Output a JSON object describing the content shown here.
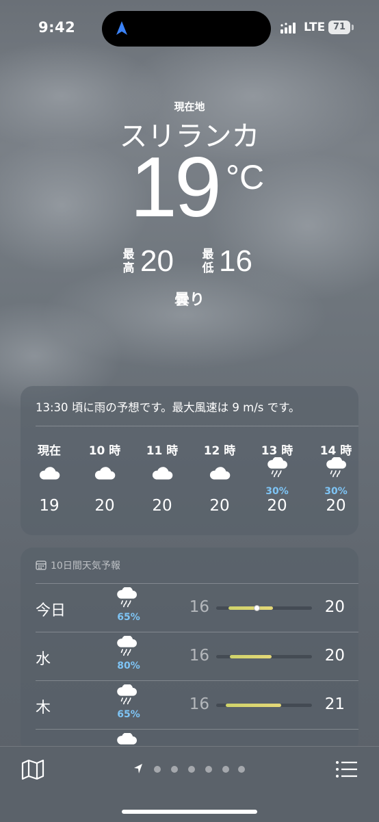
{
  "status_bar": {
    "time": "9:42",
    "network": "LTE",
    "battery": "71"
  },
  "location": {
    "label": "現在地",
    "city": "スリランカ"
  },
  "current": {
    "temp": "19",
    "unit": "°C",
    "high_label": "最高",
    "high": "20",
    "low_label": "最低",
    "low": "16",
    "condition": "曇り"
  },
  "hourly": {
    "summary": "13:30 頃に雨の予想です。最大風速は 9 m/s です。",
    "items": [
      {
        "label": "現在",
        "icon": "cloud-icon",
        "pct": "",
        "temp": "19"
      },
      {
        "label": "10 時",
        "icon": "cloud-icon",
        "pct": "",
        "temp": "20"
      },
      {
        "label": "11 時",
        "icon": "cloud-icon",
        "pct": "",
        "temp": "20"
      },
      {
        "label": "12 時",
        "icon": "cloud-icon",
        "pct": "",
        "temp": "20"
      },
      {
        "label": "13 時",
        "icon": "cloud-rain-icon",
        "pct": "30%",
        "temp": "20"
      },
      {
        "label": "14 時",
        "icon": "cloud-rain-icon",
        "pct": "30%",
        "temp": "20"
      }
    ]
  },
  "daily": {
    "title": "10日間天気予報",
    "days": [
      {
        "name": "今日",
        "icon": "cloud-rain-icon",
        "pct": "65%",
        "low": "16",
        "high": "20"
      },
      {
        "name": "水",
        "icon": "cloud-rain-icon",
        "pct": "80%",
        "low": "16",
        "high": "20"
      },
      {
        "name": "木",
        "icon": "cloud-rain-icon",
        "pct": "65%",
        "low": "16",
        "high": "21"
      }
    ]
  },
  "bottom_bar": {
    "left_icon": "map-icon",
    "right_icon": "list-icon",
    "page_count": 6
  },
  "colors": {
    "precip": "#7ec4f5",
    "temp_bar": "#e0d571",
    "location_arrow": "#3b82f6"
  }
}
